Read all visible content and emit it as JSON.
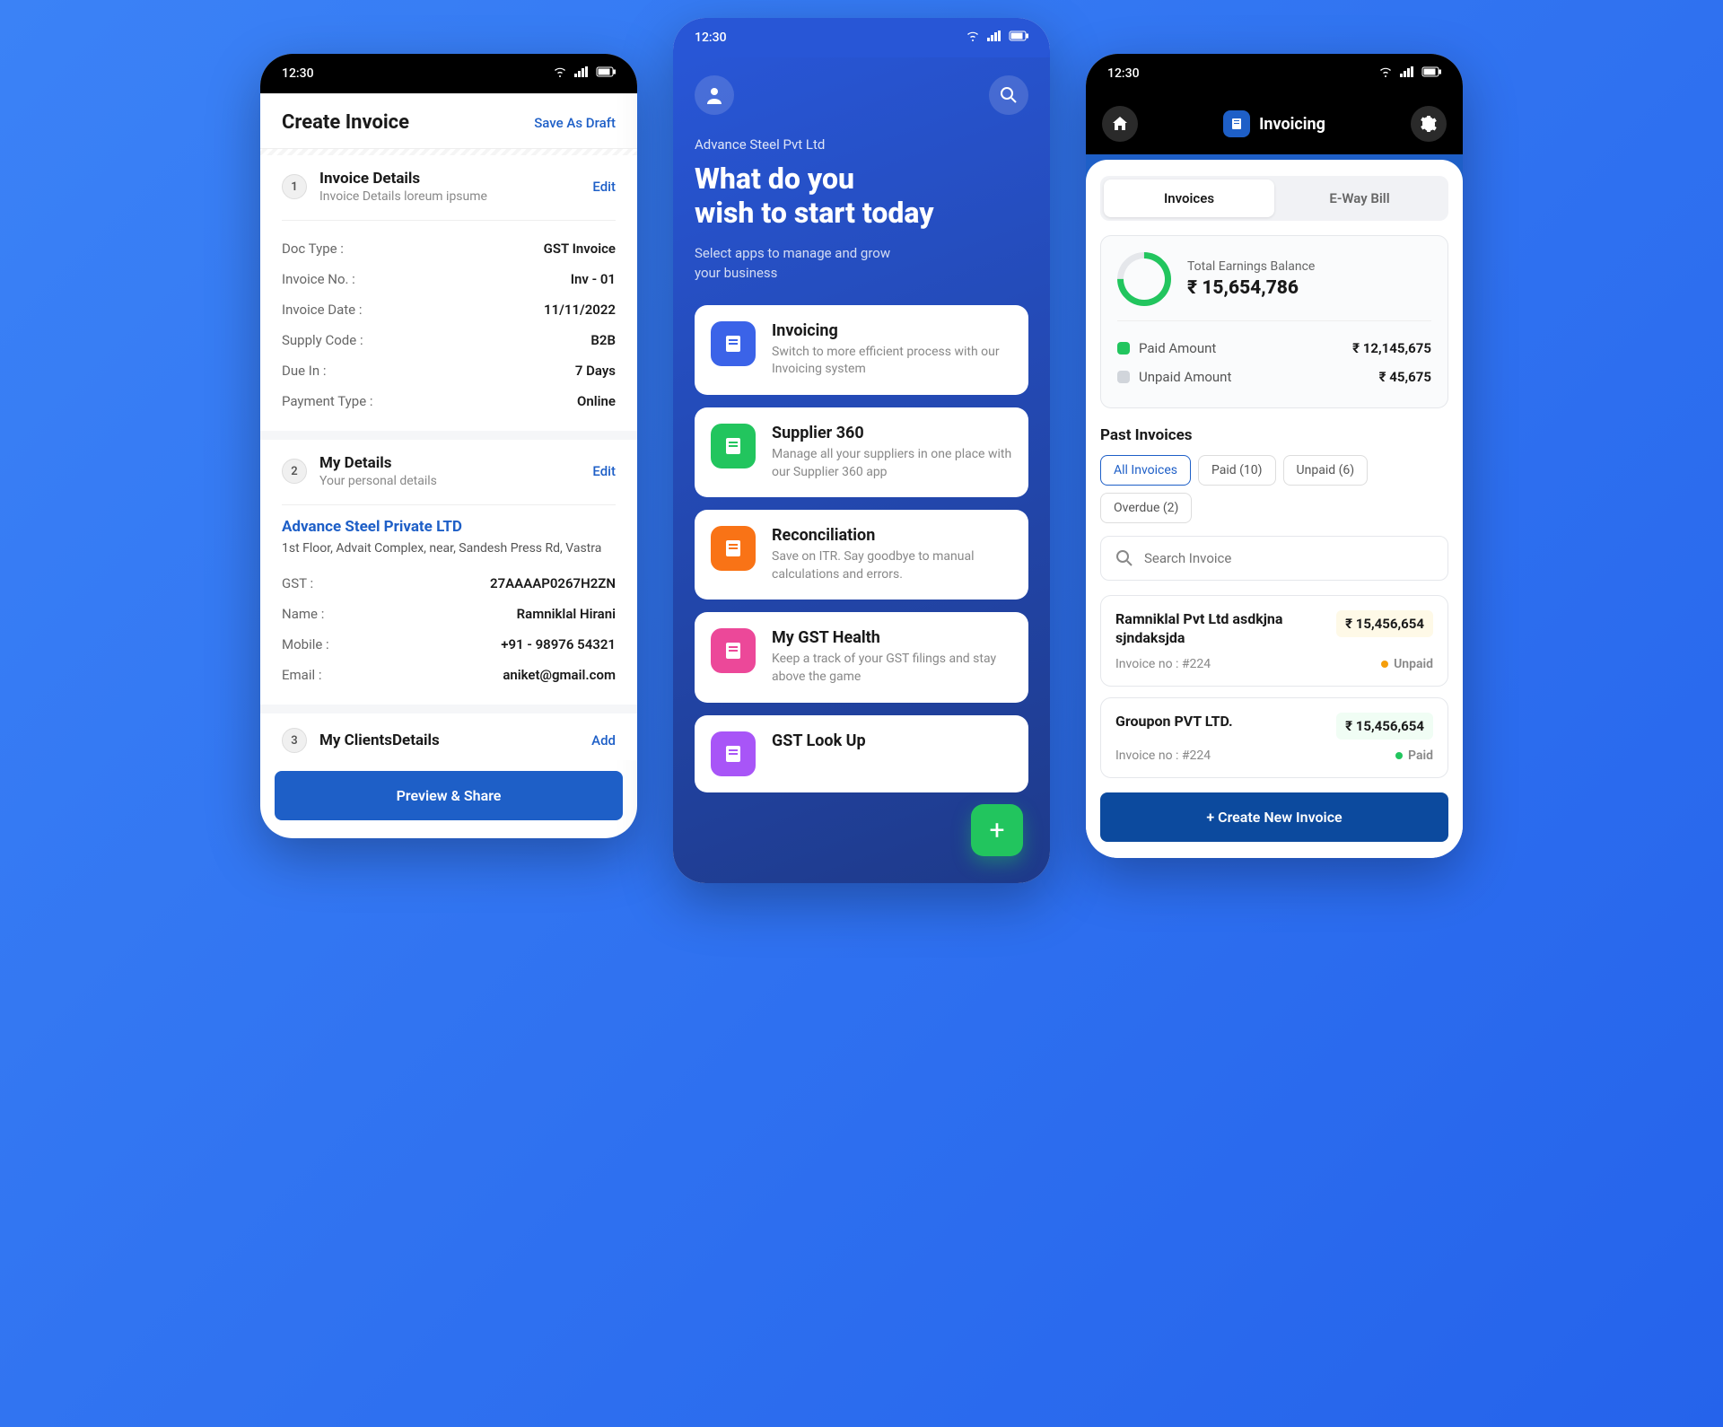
{
  "status_time": "12:30",
  "screen1": {
    "title": "Create Invoice",
    "save_draft": "Save As Draft",
    "sections": {
      "invoice": {
        "num": "1",
        "title": "Invoice Details",
        "sub": "Invoice Details loreum ipsume",
        "edit": "Edit",
        "rows": [
          {
            "label": "Doc Type :",
            "value": "GST Invoice"
          },
          {
            "label": "Invoice No. :",
            "value": "Inv - 01"
          },
          {
            "label": "Invoice Date :",
            "value": "11/11/2022"
          },
          {
            "label": "Supply Code :",
            "value": "B2B"
          },
          {
            "label": "Due In :",
            "value": "7 Days"
          },
          {
            "label": "Payment Type :",
            "value": "Online"
          }
        ]
      },
      "my_details": {
        "num": "2",
        "title": "My Details",
        "sub": "Your personal details",
        "edit": "Edit",
        "company": "Advance Steel Private LTD",
        "address": "1st Floor, Advait Complex, near, Sandesh Press Rd, Vastra",
        "rows": [
          {
            "label": "GST :",
            "value": "27AAAAP0267H2ZN"
          },
          {
            "label": "Name :",
            "value": "Ramniklal Hirani"
          },
          {
            "label": "Mobile :",
            "value": "+91 - 98976 54321"
          },
          {
            "label": "Email :",
            "value": "aniket@gmail.com"
          }
        ]
      },
      "clients": {
        "num": "3",
        "title": "My ClientsDetails",
        "add": "Add"
      }
    },
    "preview_btn": "Preview & Share"
  },
  "screen2": {
    "company": "Advance Steel Pvt Ltd",
    "hero_l1": "What do you",
    "hero_l2": "wish to start today",
    "sub_l1": "Select apps to manage and grow",
    "sub_l2": "your business",
    "apps": [
      {
        "title": "Invoicing",
        "desc": "Switch to more efficient process with our Invoicing system",
        "color": "#3b63e8",
        "icon": "receipt"
      },
      {
        "title": "Supplier 360",
        "desc": "Manage all your suppliers in one place with our Supplier 360 app",
        "color": "#22c55e",
        "icon": "users"
      },
      {
        "title": "Reconciliation",
        "desc": "Save on ITR. Say goodbye to manual calculations and errors.",
        "color": "#f97316",
        "icon": "tax"
      },
      {
        "title": "My GST Health",
        "desc": "Keep a track of your GST filings and stay above the game",
        "color": "#ec4899",
        "icon": "heart"
      },
      {
        "title": "GST Look Up",
        "desc": "",
        "color": "#a855f7",
        "icon": "search"
      }
    ]
  },
  "screen3": {
    "header_title": "Invoicing",
    "tabs": [
      "Invoices",
      "E-Way Bill"
    ],
    "balance_label": "Total Earnings Balance",
    "balance_amount": "₹ 15,654,786",
    "paid_label": "Paid Amount",
    "paid_amount": "₹ 12,145,675",
    "unpaid_label": "Unpaid Amount",
    "unpaid_amount": "₹ 45,675",
    "past_title": "Past Invoices",
    "filters": [
      "All Invoices",
      "Paid (10)",
      "Unpaid (6)",
      "Overdue (2)"
    ],
    "search_placeholder": "Search Invoice",
    "invoices": [
      {
        "name": "Ramniklal Pvt Ltd asdkjna sjndaksjda",
        "amount": "₹ 15,456,654",
        "inv_no": "Invoice no : #224",
        "status": "Unpaid",
        "status_color": "#f59e0b",
        "amt_class": ""
      },
      {
        "name": "Groupon PVT LTD.",
        "amount": "₹ 15,456,654",
        "inv_no": "Invoice no : #224",
        "status": "Paid",
        "status_color": "#22c55e",
        "amt_class": "paid"
      }
    ],
    "create_btn": "+ Create New Invoice"
  },
  "colors": {
    "paid_dot": "#22c55e",
    "unpaid_dot": "#d1d5db"
  }
}
